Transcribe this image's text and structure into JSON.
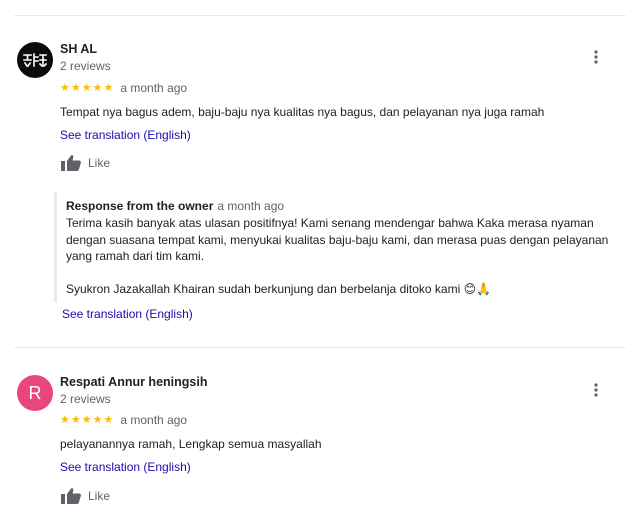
{
  "reviews": [
    {
      "name": "SH AL",
      "meta": "2 reviews",
      "rating": 5,
      "time": "a month ago",
      "text": "Tempat nya bagus adem, baju-baju nya kualitas nya bagus, dan pelayanan nya juga ramah",
      "translation_link": "See translation (English)",
      "like_label": "Like",
      "response": {
        "owner_label": "Response from the owner",
        "time": "a month ago",
        "paragraphs": [
          "Terima kasih banyak atas ulasan positifnya! Kami senang mendengar bahwa Kaka merasa nyaman dengan suasana tempat kami, menyukai kualitas baju-baju kami, dan merasa puas dengan pelayanan yang ramah dari tim kami.",
          "Syukron Jazakallah Khairan sudah berkunjung dan berbelanja ditoko kami 😊🙏"
        ],
        "translation_link": "See translation (English)"
      }
    },
    {
      "name": "Respati Annur heningsih",
      "avatar_letter": "R",
      "avatar_color": "#e8467c",
      "meta": "2 reviews",
      "rating": 5,
      "time": "a month ago",
      "text": "pelayanannya ramah, Lengkap semua masyallah",
      "translation_link": "See translation (English)",
      "like_label": "Like"
    }
  ],
  "colors": {
    "star": "#fbbc04",
    "link": "#1a0dab",
    "secondary_text": "#5f6368",
    "divider": "#e8eaed"
  }
}
